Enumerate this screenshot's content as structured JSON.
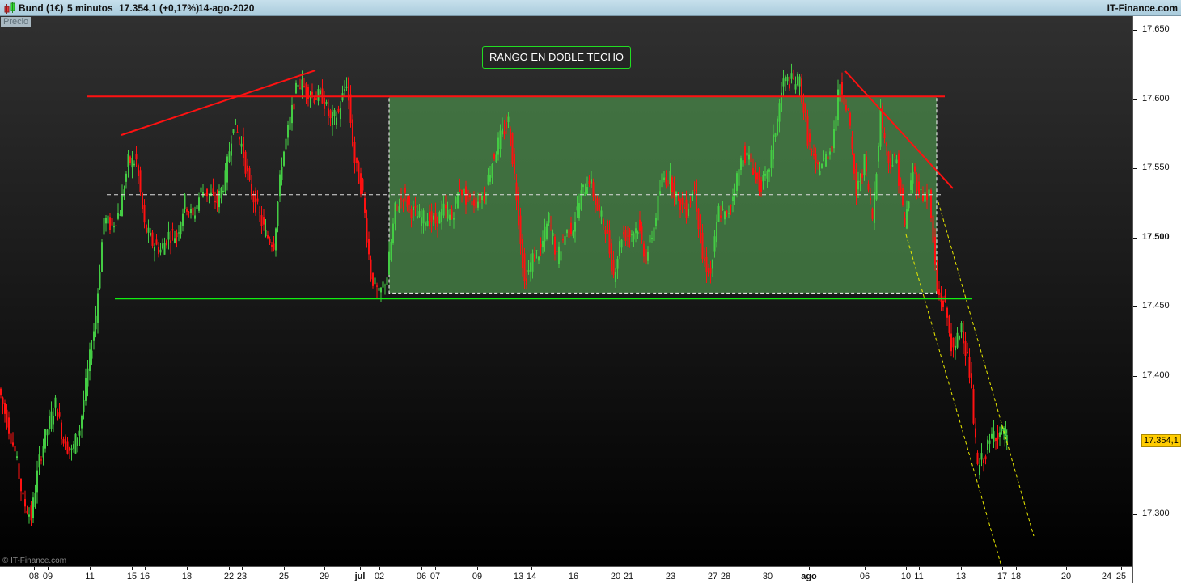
{
  "header": {
    "instrument": "Bund (1€)",
    "timeframe": "5 minutos",
    "last_quote": "17.354,1 (+0,17%)",
    "date": "14-ago-2020",
    "brand": "IT-Finance.com",
    "icon": "candlestick-icon"
  },
  "panel_label": "Precio",
  "watermark": "© IT-Finance.com",
  "chart_data": {
    "type": "candlestick",
    "title": "",
    "ylabel": "",
    "xlabel": "",
    "ylim": [
      17.26,
      17.665
    ],
    "y_ticks": [
      "17.650",
      "17.600",
      "17.550",
      "17.500",
      "17.450",
      "17.400",
      "17.350",
      "17.300"
    ],
    "y_tick_values": [
      17.65,
      17.6,
      17.55,
      17.5,
      17.45,
      17.4,
      17.35,
      17.3
    ],
    "bold_y_tick": "17.500",
    "x_ticks": [
      "08",
      "09",
      "11",
      "15",
      "16",
      "18",
      "22",
      "23",
      "25",
      "29",
      "jul",
      "02",
      "06",
      "07",
      "09",
      "13",
      "14",
      "16",
      "20",
      "21",
      "23",
      "27",
      "28",
      "30",
      "ago",
      "06",
      "10",
      "11",
      "13",
      "17",
      "18",
      "20",
      "24",
      "25"
    ],
    "bold_x_ticks": [
      "jul",
      "ago"
    ],
    "last_price_label": "17.354,1",
    "colors": {
      "up": "#44cc44",
      "down": "#ff1111",
      "resistance": "#ff1111",
      "support": "#11ee11",
      "range_fill": "#4a8a4a",
      "channel": "#e8e800"
    },
    "price_path": [
      17.391,
      17.368,
      17.345,
      17.31,
      17.298,
      17.339,
      17.362,
      17.38,
      17.353,
      17.345,
      17.362,
      17.403,
      17.444,
      17.514,
      17.508,
      17.52,
      17.555,
      17.555,
      17.508,
      17.496,
      17.491,
      17.502,
      17.502,
      17.526,
      17.514,
      17.534,
      17.531,
      17.526,
      17.543,
      17.584,
      17.567,
      17.537,
      17.52,
      17.502,
      17.496,
      17.555,
      17.584,
      17.613,
      17.607,
      17.602,
      17.602,
      17.584,
      17.59,
      17.613,
      17.555,
      17.531,
      17.473,
      17.458,
      17.473,
      17.52,
      17.531,
      17.52,
      17.514,
      17.514,
      17.511,
      17.52,
      17.514,
      17.537,
      17.526,
      17.526,
      17.531,
      17.555,
      17.572,
      17.584,
      17.531,
      17.467,
      17.485,
      17.491,
      17.514,
      17.485,
      17.502,
      17.508,
      17.531,
      17.543,
      17.52,
      17.508,
      17.473,
      17.502,
      17.502,
      17.508,
      17.485,
      17.508,
      17.543,
      17.543,
      17.526,
      17.52,
      17.537,
      17.485,
      17.473,
      17.52,
      17.514,
      17.537,
      17.561,
      17.555,
      17.537,
      17.543,
      17.578,
      17.613,
      17.613,
      17.613,
      17.572,
      17.549,
      17.555,
      17.567,
      17.613,
      17.59,
      17.531,
      17.555,
      17.514,
      17.59,
      17.555,
      17.555,
      17.508,
      17.549,
      17.531,
      17.531,
      17.461,
      17.45,
      17.415,
      17.438,
      17.403,
      17.333,
      17.345,
      17.359,
      17.359,
      17.354
    ],
    "annotations": {
      "label": "RANGO EN DOBLE TECHO",
      "resistance_price": 17.602,
      "support_price": 17.456,
      "range_mid_price": 17.531
    }
  }
}
